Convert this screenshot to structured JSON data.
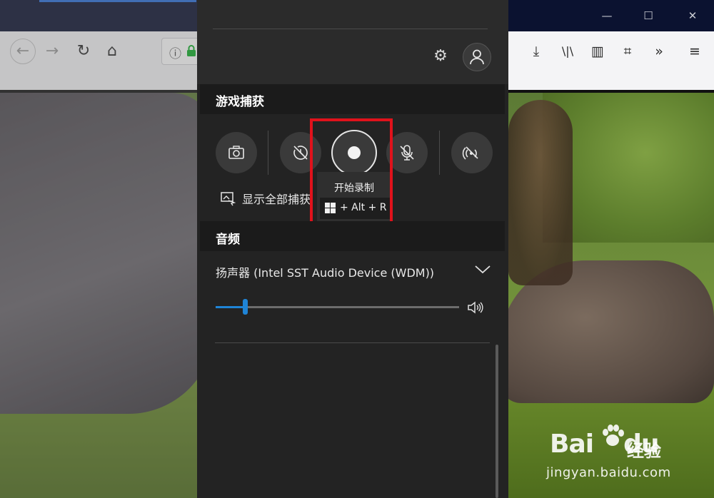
{
  "browser": {
    "window_controls": {
      "minimize": "—",
      "maximize": "☐",
      "close": "✕"
    },
    "nav": {
      "back": "←",
      "forward": "→",
      "reload": "↻",
      "home": "⌂"
    },
    "urlbar": {
      "info_icon": "ⓘ",
      "lock_icon": "lock-icon"
    },
    "tools": {
      "download": "⤓",
      "library": "\\|\\",
      "sidebar": "▥",
      "screenshot": "⌗",
      "overflow": "»",
      "menu": "≡"
    }
  },
  "game_bar": {
    "settings_icon": "⚙",
    "capture": {
      "title": "游戏捕获",
      "show_all_label": "显示全部捕获"
    },
    "record_tooltip": {
      "title": "开始录制",
      "shortcut": "+ Alt + R"
    },
    "audio": {
      "title": "音频",
      "device": "扬声器 (Intel SST Audio Device (WDM))",
      "volume_level": 0.12
    }
  },
  "watermark": {
    "brand": "Bai",
    "brand_tail": "du",
    "experience": "经验",
    "url": "jingyan.baidu.com"
  },
  "colors": {
    "highlight": "#e0121b",
    "slider": "#1f84d6",
    "panel": "#232323"
  }
}
